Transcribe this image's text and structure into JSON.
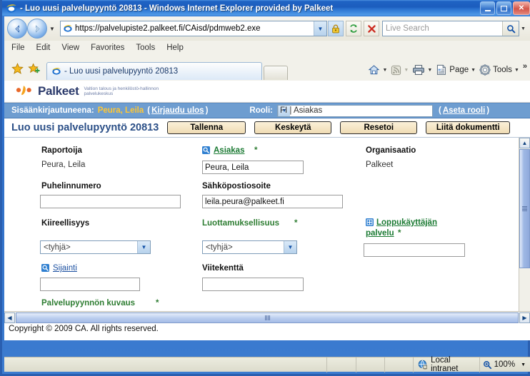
{
  "window": {
    "title": "- Luo uusi palvelupyyntö 20813 - Windows Internet Explorer provided by Palkeet",
    "minimize_label": "–",
    "maximize_label": "❑",
    "close_label": "✕"
  },
  "nav": {
    "back_glyph": "←",
    "forward_glyph": "→",
    "history_caret": "▼"
  },
  "address": {
    "url": "https://palvelupiste2.palkeet.fi/CAisd/pdmweb2.exe",
    "dropdown_caret": "▼"
  },
  "search": {
    "placeholder": "Live Search",
    "dropdown_caret": "▼"
  },
  "menu": {
    "items": [
      "File",
      "Edit",
      "View",
      "Favorites",
      "Tools",
      "Help"
    ]
  },
  "tab": {
    "label": "- Luo uusi palvelupyyntö 20813"
  },
  "command_bar": {
    "home_caret": "▼",
    "feeds_caret": "▼",
    "print_caret": "▼",
    "page_label": "Page",
    "page_caret": "▼",
    "tools_label": "Tools",
    "tools_caret": "▼",
    "overflow": "»"
  },
  "brand": {
    "word": "Palkeet",
    "tagline": "Valtion talous ja henkilöstö-hallinnon palvelukeskus"
  },
  "userbar": {
    "logged_in_label": "Sisäänkirjautuneena:",
    "user_name": "Peura, Leila",
    "logout_open": "(",
    "logout_link": "Kirjaudu ulos",
    "logout_close": ")",
    "role_label": "Rooli:",
    "role_value": "FI | Asiakas",
    "role_caret": "▼",
    "set_role_open": "(",
    "set_role_link": "Aseta rooli",
    "set_role_close": ")"
  },
  "action_bar": {
    "page_title": "Luo uusi palvelupyyntö 20813",
    "buttons": [
      {
        "label": "Tallenna",
        "name": "save-button"
      },
      {
        "label": "Keskeytä",
        "name": "cancel-button"
      },
      {
        "label": "Resetoi",
        "name": "reset-button"
      },
      {
        "label": "Liitä dokumentti",
        "name": "attach-document-button"
      }
    ]
  },
  "form": {
    "reporter": {
      "label": "Raportoija",
      "value": "Peura, Leila"
    },
    "customer": {
      "label": "Asiakas",
      "star": "*",
      "value": "Peura, Leila",
      "icon": "search-icon"
    },
    "organisation": {
      "label": "Organisaatio",
      "value": "Palkeet"
    },
    "phone": {
      "label": "Puhelinnumero",
      "value": ""
    },
    "email": {
      "label": "Sähköpostiosoite",
      "value": "leila.peura@palkeet.fi"
    },
    "urgency": {
      "label": "Kiireellisyys",
      "value": "<tyhjä>",
      "caret": "▼"
    },
    "confidentiality": {
      "label": "Luottamuksellisuus",
      "star": "*",
      "value": "<tyhjä>",
      "caret": "▼"
    },
    "end_user_service": {
      "label_line1": "Loppukäyttäjän",
      "label_line2": "palvelu",
      "star": "*",
      "value": "",
      "icon": "grid-picker-icon"
    },
    "location": {
      "label": "Sijainti",
      "value": "",
      "icon": "search-icon"
    },
    "reference": {
      "label": "Viitekenttä",
      "value": ""
    },
    "description": {
      "label": "Palvelupyynnön kuvaus",
      "star": "*"
    }
  },
  "scrollbars": {
    "up_glyph": "▲",
    "down_glyph": "▼",
    "left_glyph": "◀",
    "right_glyph": "▶"
  },
  "footer": {
    "copyright": "Copyright © 2009 CA. All rights reserved."
  },
  "status": {
    "zone": "Local intranet",
    "zoom": "100%",
    "zoom_caret": "▼"
  },
  "colors": {
    "brand_blue": "#2b3a6b",
    "userbar_blue": "#6e9dd0",
    "user_name_yellow": "#ffc733",
    "required_green": "#2e7d32",
    "link_blue": "#1a4fa0",
    "title_blue": "#2b4f87",
    "button_tan": "#efdcb4"
  }
}
